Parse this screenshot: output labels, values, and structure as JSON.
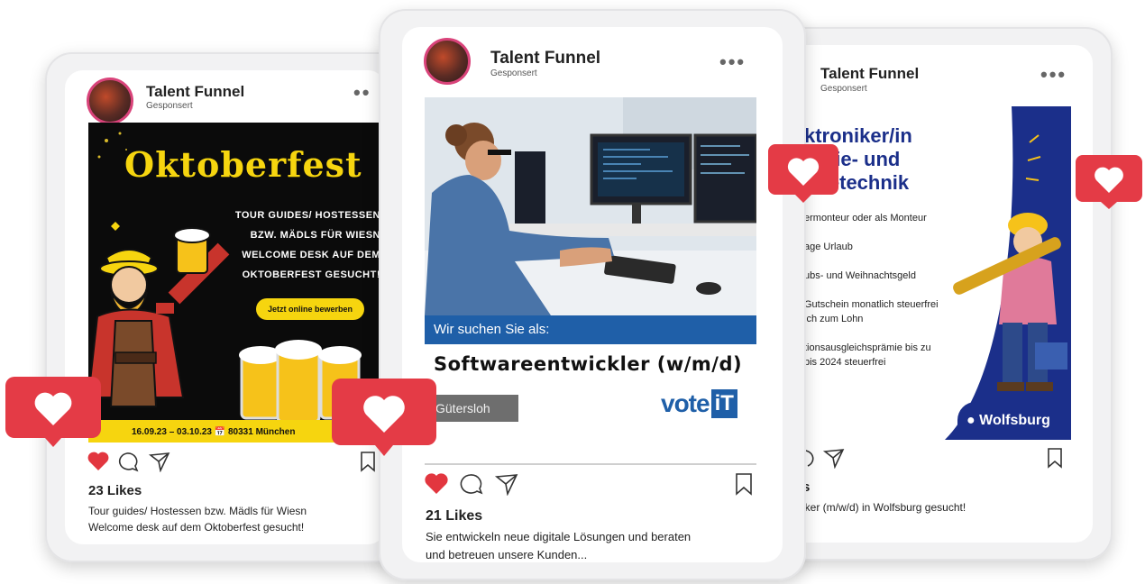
{
  "colors": {
    "accent_red": "#e2363f",
    "brand_blue": "#1f5fa8",
    "oktober_yellow": "#f6d50f",
    "dark_navy": "#1b2f8a"
  },
  "cards": [
    {
      "account": "Talent Funnel",
      "sponsored": "Gesponsert",
      "likes": "23 Likes",
      "caption_lines": [
        "Tour guides/ Hostessen bzw. Mädls für Wiesn",
        "Welcome desk auf dem Oktoberfest gesucht!"
      ],
      "image": {
        "title": "Oktoberfest",
        "lines": [
          "TOUR GUIDES/ HOSTESSEN",
          "BZW. MÄDLS FÜR WIESN",
          "WELCOME DESK AUF DEM",
          "OKTOBERFEST GESUCHT!"
        ],
        "cta": "Jetzt online bewerben",
        "footer": "16.09.23 – 03.10.23 📅 80331 München"
      }
    },
    {
      "account": "Talent Funnel",
      "sponsored": "Gesponsert",
      "likes": "21 Likes",
      "caption_lines": [
        "Sie entwickeln neue digitale Lösungen und beraten",
        "und betreuen unsere Kunden..."
      ],
      "image": {
        "banner": "Wir suchen Sie als:",
        "job": "Softwareentwickler (w/m/d)",
        "location": "Gütersloh",
        "logo_text": "vote",
        "logo_box": "iT"
      }
    },
    {
      "account": "Talent Funnel",
      "sponsored": "Gesponsert",
      "likes": "s",
      "caption_lines": [
        "iker (m/w/d) in Wolfsburg gesucht!"
      ],
      "image": {
        "title_lines": [
          "ktroniker/in",
          "ergie- und",
          "udetechnik"
        ],
        "bullets": [
          "ermonteur oder als Monteur",
          "age Urlaub",
          "ubs- und Weihnachtsgeld",
          "Gutschein monatlich steuerfrei",
          "ich zum Lohn",
          "tionsausgleichsprämie bis zu",
          "bis 2024 steuerfrei"
        ],
        "location": "Wolfsburg"
      }
    }
  ],
  "icons": [
    "heart-icon",
    "comment-icon",
    "share-icon",
    "bookmark-icon",
    "more-dots-icon",
    "location-pin-icon",
    "heart-notification-icon"
  ]
}
